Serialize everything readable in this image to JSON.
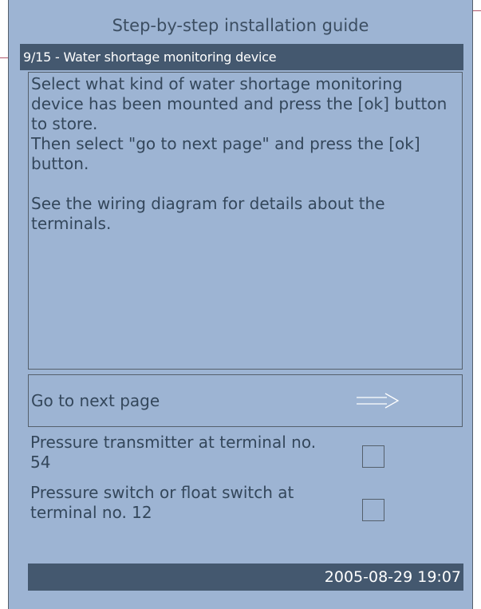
{
  "header": {
    "title": "Step-by-step installation guide",
    "step_label": "9/15 - Water shortage monitoring device"
  },
  "description": {
    "line1": "Select what kind of water shortage monitoring device has been mounted and press the [ok] button to store.",
    "line2": "Then select \"go to next page\" and press the [ok] button.",
    "line3": "See the wiring diagram for details about the terminals."
  },
  "next_page": {
    "label": "Go to next page",
    "icon": "right-arrow-icon"
  },
  "options": [
    {
      "label": "Pressure transmitter at terminal no. 54",
      "checked": false
    },
    {
      "label": "Pressure switch or float switch at terminal no. 12",
      "checked": false
    }
  ],
  "status": {
    "datetime": "2005-08-29 19:07"
  },
  "colors": {
    "panel": "#9db4d3",
    "bar": "#44586f",
    "text": "#34475b"
  }
}
